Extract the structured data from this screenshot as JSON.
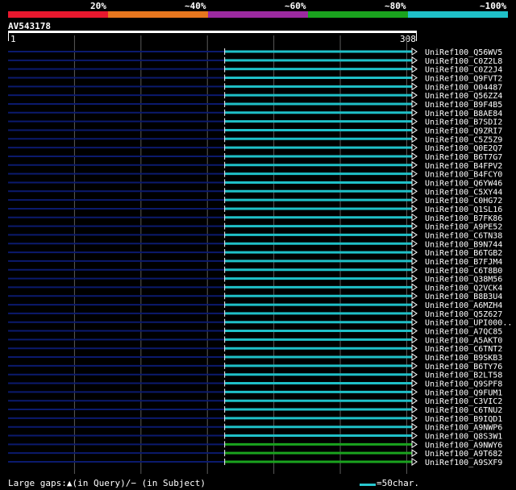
{
  "scale": {
    "labels": [
      "20%",
      "~40%",
      "~60%",
      "~80%",
      "~100%"
    ],
    "colors": [
      "#e8182e",
      "#e7761e",
      "#9c2aa0",
      "#1aa31e",
      "#1fc0c8"
    ]
  },
  "query": {
    "name": "AV543178",
    "start": "1",
    "end": "308",
    "length": 308
  },
  "chart_data": {
    "type": "alignment-overview",
    "x_range": [
      1,
      308
    ],
    "hits": [
      {
        "id": "UniRef100_Q56WV5",
        "start": 164,
        "end": 308,
        "identity": "~100%"
      },
      {
        "id": "UniRef100_C0Z2L8",
        "start": 164,
        "end": 308,
        "identity": "~100%"
      },
      {
        "id": "UniRef100_C0Z2J4",
        "start": 164,
        "end": 308,
        "identity": "~100%"
      },
      {
        "id": "UniRef100_Q9FVT2",
        "start": 164,
        "end": 308,
        "identity": "~100%"
      },
      {
        "id": "UniRef100_O04487",
        "start": 164,
        "end": 308,
        "identity": "~100%"
      },
      {
        "id": "UniRef100_Q56ZZ4",
        "start": 164,
        "end": 308,
        "identity": "~100%"
      },
      {
        "id": "UniRef100_B9F4B5",
        "start": 164,
        "end": 308,
        "identity": "~100%"
      },
      {
        "id": "UniRef100_B8AE84",
        "start": 164,
        "end": 308,
        "identity": "~100%"
      },
      {
        "id": "UniRef100_B7SDI2",
        "start": 164,
        "end": 308,
        "identity": "~100%"
      },
      {
        "id": "UniRef100_Q9ZRI7",
        "start": 164,
        "end": 308,
        "identity": "~100%"
      },
      {
        "id": "UniRef100_C5Z5Z9",
        "start": 164,
        "end": 308,
        "identity": "~100%"
      },
      {
        "id": "UniRef100_Q0E2Q7",
        "start": 164,
        "end": 308,
        "identity": "~100%"
      },
      {
        "id": "UniRef100_B6T7G7",
        "start": 164,
        "end": 308,
        "identity": "~100%"
      },
      {
        "id": "UniRef100_B4FPV2",
        "start": 164,
        "end": 308,
        "identity": "~100%"
      },
      {
        "id": "UniRef100_B4FCY0",
        "start": 164,
        "end": 308,
        "identity": "~100%"
      },
      {
        "id": "UniRef100_Q6YW46",
        "start": 164,
        "end": 308,
        "identity": "~100%"
      },
      {
        "id": "UniRef100_C5XY44",
        "start": 164,
        "end": 308,
        "identity": "~100%"
      },
      {
        "id": "UniRef100_C0HG72",
        "start": 164,
        "end": 308,
        "identity": "~100%"
      },
      {
        "id": "UniRef100_Q1SL16",
        "start": 164,
        "end": 308,
        "identity": "~100%"
      },
      {
        "id": "UniRef100_B7FK86",
        "start": 164,
        "end": 308,
        "identity": "~100%"
      },
      {
        "id": "UniRef100_A9PE52",
        "start": 164,
        "end": 308,
        "identity": "~100%"
      },
      {
        "id": "UniRef100_C6TN38",
        "start": 164,
        "end": 308,
        "identity": "~100%"
      },
      {
        "id": "UniRef100_B9N744",
        "start": 164,
        "end": 308,
        "identity": "~100%"
      },
      {
        "id": "UniRef100_B6TGB2",
        "start": 164,
        "end": 308,
        "identity": "~100%"
      },
      {
        "id": "UniRef100_B7FJM4",
        "start": 164,
        "end": 308,
        "identity": "~100%"
      },
      {
        "id": "UniRef100_C6T8B0",
        "start": 164,
        "end": 308,
        "identity": "~100%"
      },
      {
        "id": "UniRef100_Q38M56",
        "start": 164,
        "end": 308,
        "identity": "~100%"
      },
      {
        "id": "UniRef100_Q2VCK4",
        "start": 164,
        "end": 308,
        "identity": "~100%"
      },
      {
        "id": "UniRef100_B8B3U4",
        "start": 164,
        "end": 308,
        "identity": "~100%"
      },
      {
        "id": "UniRef100_A6MZH4",
        "start": 164,
        "end": 308,
        "identity": "~100%"
      },
      {
        "id": "UniRef100_Q5Z627",
        "start": 164,
        "end": 308,
        "identity": "~100%"
      },
      {
        "id": "UniRef100_UPI000..",
        "start": 164,
        "end": 308,
        "identity": "~100%"
      },
      {
        "id": "UniRef100_A7QC85",
        "start": 164,
        "end": 308,
        "identity": "~100%"
      },
      {
        "id": "UniRef100_A5AKT0",
        "start": 164,
        "end": 308,
        "identity": "~100%"
      },
      {
        "id": "UniRef100_C6TNT2",
        "start": 164,
        "end": 308,
        "identity": "~100%"
      },
      {
        "id": "UniRef100_B9SKB3",
        "start": 164,
        "end": 308,
        "identity": "~100%"
      },
      {
        "id": "UniRef100_B6TY76",
        "start": 164,
        "end": 308,
        "identity": "~100%"
      },
      {
        "id": "UniRef100_B2LT58",
        "start": 164,
        "end": 308,
        "identity": "~100%"
      },
      {
        "id": "UniRef100_Q9SPF8",
        "start": 164,
        "end": 308,
        "identity": "~100%"
      },
      {
        "id": "UniRef100_Q9FUM1",
        "start": 164,
        "end": 308,
        "identity": "~100%"
      },
      {
        "id": "UniRef100_C3VIC2",
        "start": 164,
        "end": 308,
        "identity": "~100%"
      },
      {
        "id": "UniRef100_C6TNU2",
        "start": 164,
        "end": 308,
        "identity": "~100%"
      },
      {
        "id": "UniRef100_B9IQD1",
        "start": 164,
        "end": 308,
        "identity": "~100%"
      },
      {
        "id": "UniRef100_A9NWP6",
        "start": 164,
        "end": 308,
        "identity": "~100%"
      },
      {
        "id": "UniRef100_Q8S3W1",
        "start": 164,
        "end": 308,
        "identity": "~100%"
      },
      {
        "id": "UniRef100_A9NWY6",
        "start": 164,
        "end": 308,
        "identity": "~80%"
      },
      {
        "id": "UniRef100_A9T682",
        "start": 164,
        "end": 308,
        "identity": "~80%"
      },
      {
        "id": "UniRef100_A9SXF9",
        "start": 164,
        "end": 308,
        "identity": "~80%"
      }
    ]
  },
  "footer": {
    "gaps_text": "Large gaps:▲(in Query)/− (in Subject)",
    "legend_text": "=50char."
  }
}
